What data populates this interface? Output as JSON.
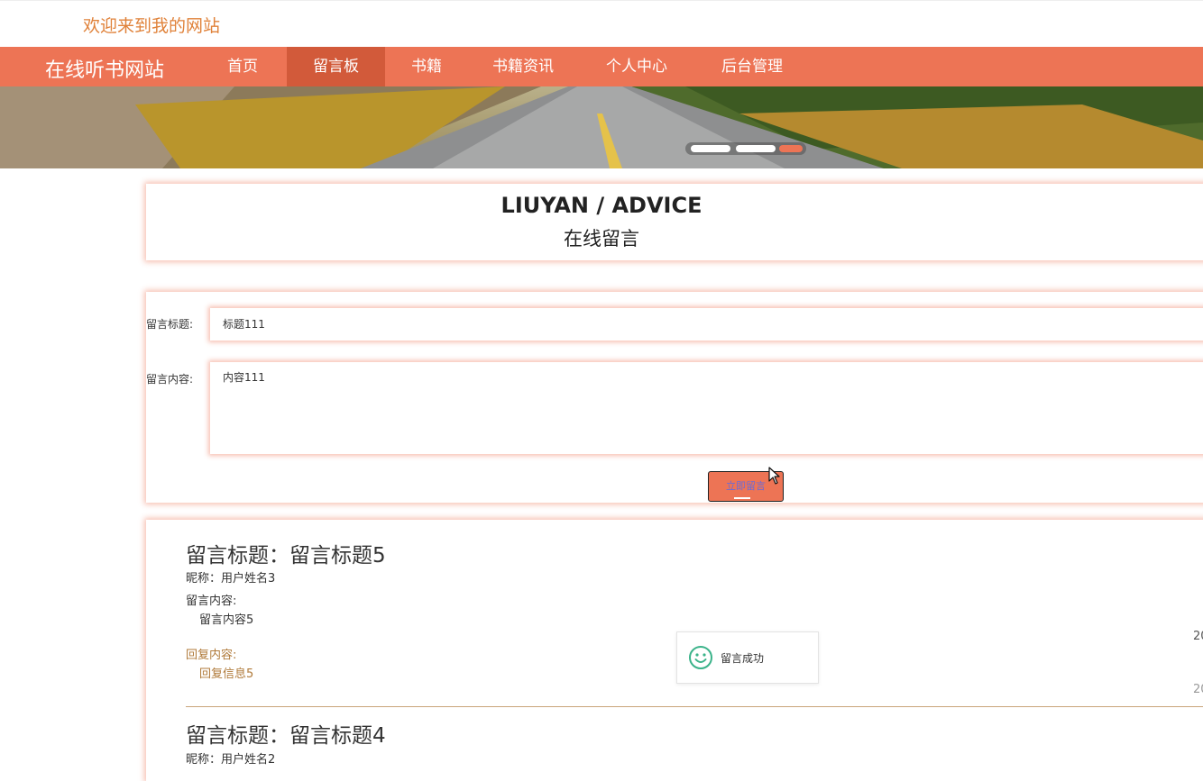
{
  "header": {
    "welcome": "欢迎来到我的网站"
  },
  "nav": {
    "site_title": "在线听书网站",
    "items": [
      {
        "label": "首页",
        "active": false
      },
      {
        "label": "留言板",
        "active": true
      },
      {
        "label": "书籍",
        "active": false
      },
      {
        "label": "书籍资讯",
        "active": false
      },
      {
        "label": "个人中心",
        "active": false
      },
      {
        "label": "后台管理",
        "active": false
      }
    ]
  },
  "banner": {
    "slide_count": 3,
    "active_slide": 3
  },
  "heading": {
    "en": "LIUYAN / ADVICE",
    "cn": "在线留言"
  },
  "form": {
    "title_label": "留言标题:",
    "title_value": "标题111",
    "content_label": "留言内容:",
    "content_value": "内容111",
    "submit_label": "立即留言"
  },
  "messages": [
    {
      "title": "留言标题：留言标题5",
      "nickname": "昵称：用户姓名3",
      "content_label": "留言内容:",
      "content": "留言内容5",
      "reply_label": "回复内容:",
      "reply": "回复信息5",
      "date1": "20",
      "date2": "20"
    },
    {
      "title": "留言标题：留言标题4",
      "nickname": "昵称：用户姓名2"
    }
  ],
  "toast": {
    "icon": "smile-icon",
    "text": "留言成功"
  },
  "colors": {
    "accent": "#ed7455",
    "accent_dark": "#d25a3a",
    "welcome_text": "#e0823a",
    "reply_text": "#b07a3a"
  }
}
